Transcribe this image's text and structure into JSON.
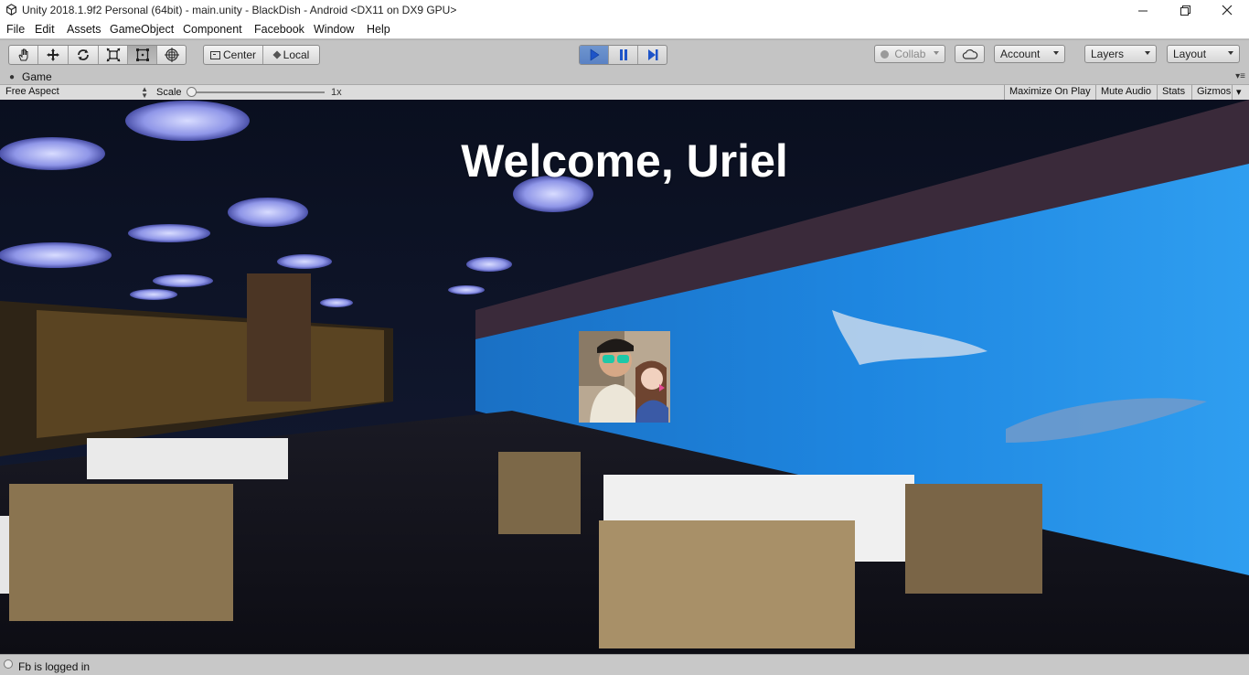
{
  "window": {
    "title": "Unity 2018.1.9f2 Personal (64bit) - main.unity - BlackDish - Android <DX11 on DX9 GPU>",
    "controls": [
      "minimize-icon",
      "maximize-icon",
      "close-icon"
    ]
  },
  "menu": [
    "File",
    "Edit",
    "Assets",
    "GameObject",
    "Component",
    "Facebook",
    "Window",
    "Help"
  ],
  "toolbar": {
    "tools": [
      "hand-tool-icon",
      "move-tool-icon",
      "rotate-tool-icon",
      "scale-tool-icon",
      "rect-tool-icon",
      "transform-tool-icon"
    ],
    "pivot_center": "Center",
    "pivot_local": "Local",
    "play_state": "playing",
    "collab": "Collab",
    "account": "Account",
    "layers": "Layers",
    "layout": "Layout"
  },
  "game_panel": {
    "tab_label": "Game",
    "aspect": "Free Aspect",
    "scale_label": "Scale",
    "scale_value": "1x",
    "scale_slider_value": 0.0,
    "buttons": {
      "maximize": "Maximize On Play",
      "mute": "Mute Audio",
      "stats": "Stats",
      "gizmos": "Gizmos"
    }
  },
  "game_view": {
    "welcome_text": "Welcome, Uriel",
    "background": "restaurant-aquarium-image",
    "profile_picture": "facebook-profile-photo"
  },
  "status": {
    "message": "Fb is logged in"
  },
  "colors": {
    "play_active": "#5a82c4",
    "editor_gray": "#c4c4c4",
    "welcome_text": "#ffffff"
  }
}
